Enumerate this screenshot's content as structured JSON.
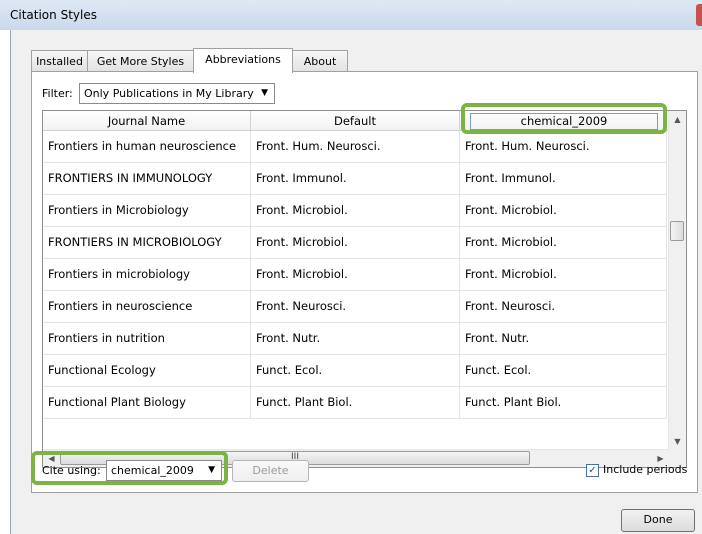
{
  "window": {
    "title": "Citation Styles"
  },
  "tabs": [
    {
      "label": "Installed"
    },
    {
      "label": "Get More Styles"
    },
    {
      "label": "Abbreviations"
    },
    {
      "label": "About"
    }
  ],
  "filter": {
    "label": "Filter:",
    "value": "Only Publications in My Library"
  },
  "table": {
    "columns": [
      "Journal Name",
      "Default",
      "chemical_2009"
    ],
    "rows": [
      [
        "Frontiers in human neuroscience",
        "Front. Hum. Neurosci.",
        "Front. Hum. Neurosci."
      ],
      [
        "FRONTIERS IN IMMUNOLOGY",
        "Front. Immunol.",
        "Front. Immunol."
      ],
      [
        "Frontiers in Microbiology",
        "Front. Microbiol.",
        "Front. Microbiol."
      ],
      [
        "FRONTIERS IN MICROBIOLOGY",
        "Front. Microbiol.",
        "Front. Microbiol."
      ],
      [
        "Frontiers in microbiology",
        "Front. Microbiol.",
        "Front. Microbiol."
      ],
      [
        "Frontiers in neuroscience",
        "Front. Neurosci.",
        "Front. Neurosci."
      ],
      [
        "Frontiers in nutrition",
        "Front. Nutr.",
        "Front. Nutr."
      ],
      [
        "Functional Ecology",
        "Funct. Ecol.",
        "Funct. Ecol."
      ],
      [
        "Functional Plant Biology",
        "Funct. Plant Biol.",
        "Funct. Plant Biol."
      ]
    ],
    "hscroll_grip": "III"
  },
  "footer": {
    "cite_label": "Cite using:",
    "cite_value": "chemical_2009",
    "delete_label": "Delete",
    "include_periods_label": "Include periods",
    "include_periods_checked": true,
    "done_label": "Done"
  },
  "colors": {
    "highlight": "#7cb342"
  }
}
